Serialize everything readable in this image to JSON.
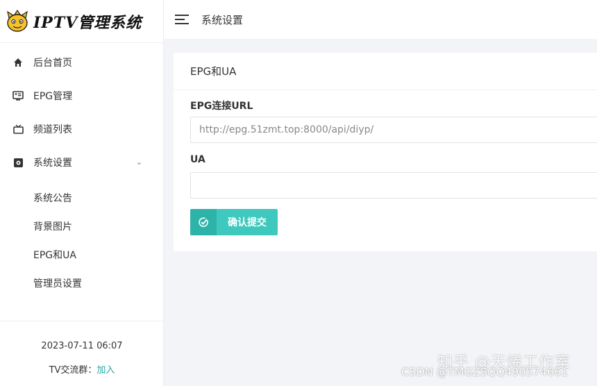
{
  "app": {
    "logo_text": "IPTV管理系统"
  },
  "sidebar": {
    "items": [
      {
        "label": "后台首页",
        "icon": "home-icon"
      },
      {
        "label": "EPG管理",
        "icon": "epg-icon"
      },
      {
        "label": "频道列表",
        "icon": "tv-icon"
      },
      {
        "label": "系统设置",
        "icon": "settings-icon"
      }
    ],
    "subitems": [
      {
        "label": "系统公告"
      },
      {
        "label": "背景图片"
      },
      {
        "label": "EPG和UA"
      },
      {
        "label": "管理员设置"
      }
    ],
    "footer": {
      "datetime": "2023-07-11 06:07",
      "group_label": "TV交流群：",
      "join_link": "加入"
    }
  },
  "header": {
    "title": "系统设置"
  },
  "card": {
    "title": "EPG和UA",
    "epg_label": "EPG连接URL",
    "epg_placeholder": "http://epg.51zmt.top:8000/api/diyp/",
    "ua_label": "UA",
    "ua_value": "",
    "submit_label": "确认提交"
  },
  "watermark": {
    "line1": "知乎 @天烯工作室",
    "line2": "CSDN @TMGZSQQ490574661"
  },
  "colors": {
    "accent": "#3fc8bd",
    "accent_dark": "#2db3a8",
    "link": "#1fa8a0"
  }
}
